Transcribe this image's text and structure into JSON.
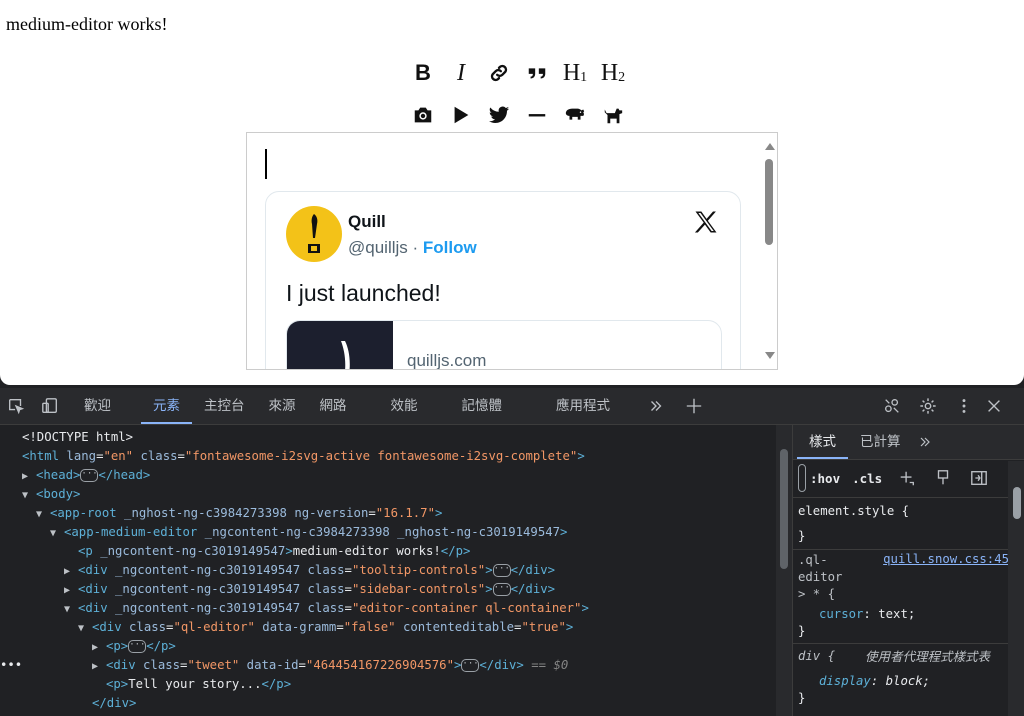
{
  "page": {
    "heading": "medium-editor works!"
  },
  "toolbar": {
    "bold": "B",
    "italic": "I",
    "h1_main": "H",
    "h1_sub": "1",
    "h2_main": "H",
    "h2_sub": "2"
  },
  "tweet": {
    "name": "Quill",
    "handle": "@quilljs",
    "separator": " · ",
    "follow": "Follow",
    "text": "I just launched!",
    "card_domain": "quilljs.com"
  },
  "devtools": {
    "tabs": [
      "歡迎",
      "元素",
      "主控台",
      "來源",
      "網路",
      "效能",
      "記憶體",
      "應用程式"
    ],
    "active_tab": "元素",
    "dom": {
      "l1": "<!DOCTYPE html>",
      "l2_tag": "<html",
      "l2_a1": " lang",
      "l2_v1": "\"en\"",
      "l2_a2": " class",
      "l2_v2": "\"fontawesome-i2svg-active fontawesome-i2svg-complete\"",
      "l2_end": ">",
      "l3_open": "<head>",
      "l3_close": "</head>",
      "l4": "<body>",
      "l5_tag": "<app-root",
      "l5_a1": " _nghost-ng-c3984273398",
      "l5_a2": " ng-version",
      "l5_v2": "\"16.1.7\"",
      "l5_end": ">",
      "l6_tag": "<app-medium-editor",
      "l6_a1": " _ngcontent-ng-c3984273398 _nghost-ng-c3019149547",
      "l6_end": ">",
      "l7_tag": "<p",
      "l7_a1": " _ngcontent-ng-c3019149547",
      "l7_mid": ">",
      "l7_text": "medium-editor works!",
      "l7_close": "</p>",
      "l8_tag": "<div",
      "l8_a1": " _ngcontent-ng-c3019149547",
      "l8_a2": " class",
      "l8_v2": "\"tooltip-controls\"",
      "l8_close": "</div>",
      "l9_tag": "<div",
      "l9_a1": " _ngcontent-ng-c3019149547",
      "l9_a2": " class",
      "l9_v2": "\"sidebar-controls\"",
      "l9_close": "</div>",
      "l10_tag": "<div",
      "l10_a1": " _ngcontent-ng-c3019149547",
      "l10_a2": " class",
      "l10_v2": "\"editor-container ql-container\"",
      "l10_end": ">",
      "l11_tag": "<div",
      "l11_a1": " class",
      "l11_v1": "\"ql-editor\"",
      "l11_a2": " data-gramm",
      "l11_v2": "\"false\"",
      "l11_a3": " contenteditable",
      "l11_v3": "\"true\"",
      "l11_end": ">",
      "l12_open": "<p>",
      "l12_close": "</p>",
      "l13_tag": "<div",
      "l13_a1": " class",
      "l13_v1": "\"tweet\"",
      "l13_a2": " data-id",
      "l13_v2": "\"464454167226904576\"",
      "l13_mid": ">",
      "l13_close": "</div>",
      "l13_comment": " == $0",
      "l14_open": "<p>",
      "l14_text": "Tell your story...",
      "l14_close": "</p>",
      "l15": "</div>"
    },
    "styles": {
      "tabs": [
        "樣式",
        "已計算"
      ],
      "hov": ":hov",
      "cls": ".cls",
      "element_style": "element.style {",
      "close_brace": "}",
      "rule1_sel1": ".ql-",
      "rule1_sel2": "editor",
      "rule1_sel3": "> * {",
      "rule1_link": "quill.snow.css:45",
      "rule1_prop": "cursor",
      "rule1_val": ": text;",
      "rule2_sel": "div {",
      "rule2_source": "使用者代理程式樣式表",
      "rule2_prop": "display",
      "rule2_val": ": block;"
    }
  }
}
